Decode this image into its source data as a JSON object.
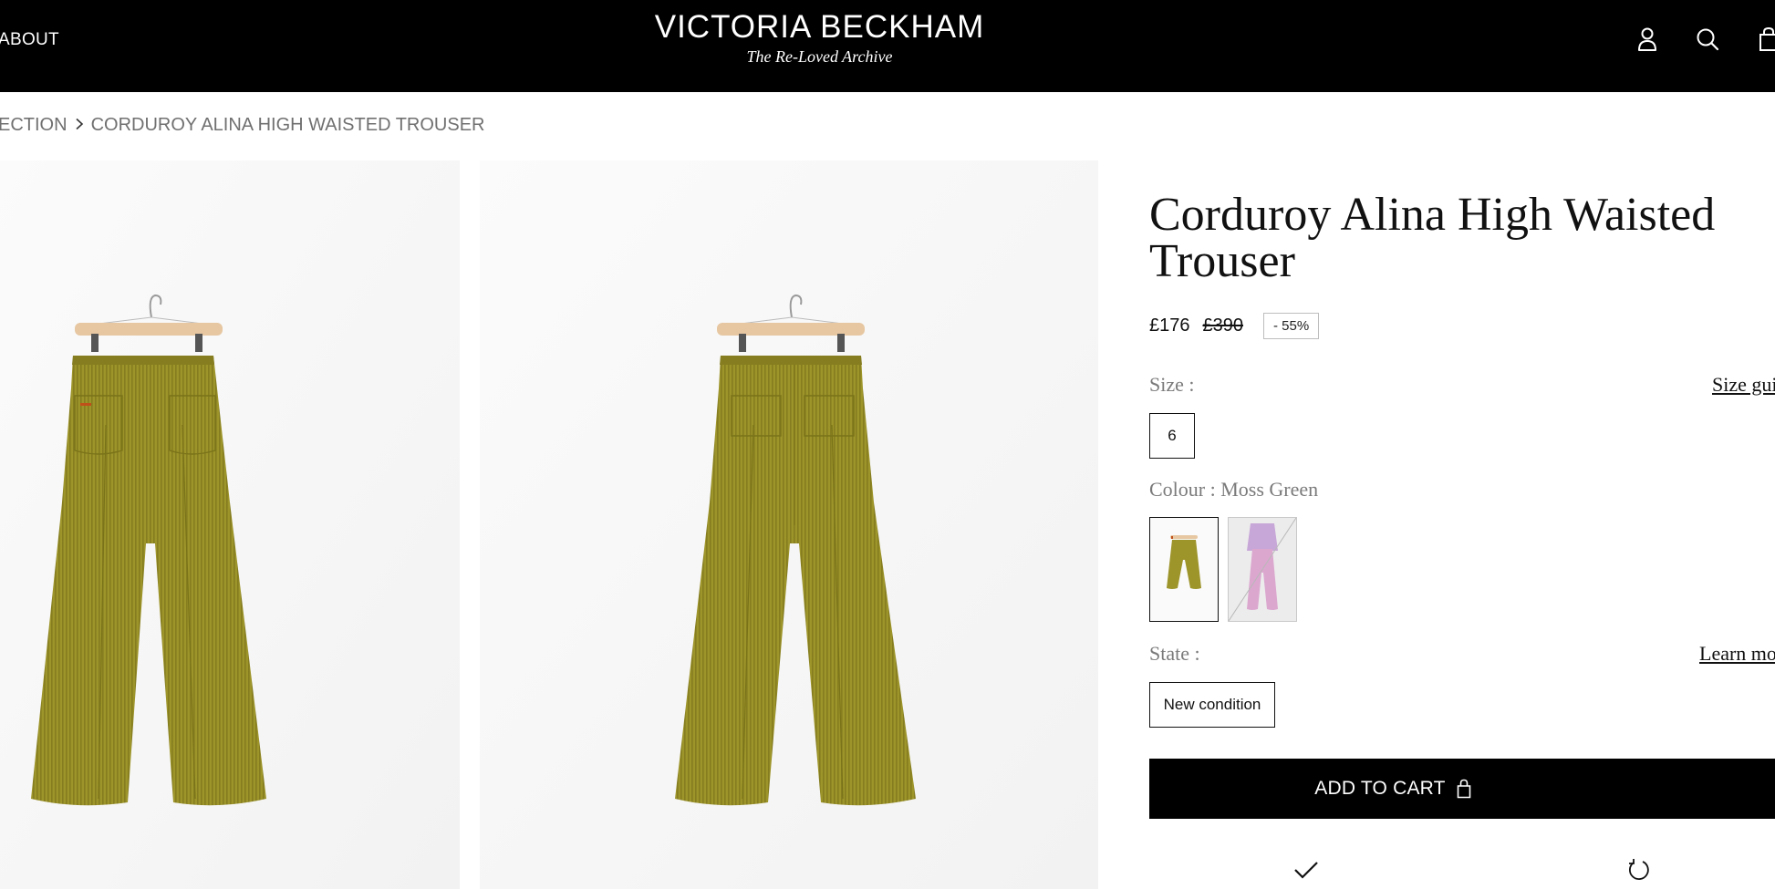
{
  "header": {
    "nav_about": "ABOUT",
    "brand_name": "VICTORIA BECKHAM",
    "brand_subtitle": "The Re-Loved Archive",
    "icons": [
      "account-icon",
      "search-icon",
      "shopping-bag-icon"
    ]
  },
  "breadcrumb": {
    "items": [
      "ECTION",
      "CORDUROY ALINA HIGH WAISTED TROUSER"
    ],
    "separator": "chevron-right-icon"
  },
  "product": {
    "title": "Corduroy Alina High Waisted Trouser",
    "price": "£176",
    "original_price": "£390",
    "discount": "- 55%",
    "size_label": "Size :",
    "size_guide_link": "Size gui",
    "sizes": [
      "6"
    ],
    "colour_label": "Colour : Moss Green",
    "colours": [
      "moss-green",
      "lilac"
    ],
    "state_label": "State :",
    "learn_more_link": "Learn mo",
    "states": [
      "New condition"
    ],
    "add_to_cart": "ADD TO CART",
    "trust_icons": [
      "checkmark-icon",
      "return-icon"
    ]
  },
  "colors": {
    "header_bg": "#000000",
    "trouser_green": "#9a9228",
    "lilac_swatch": "#d8a8cf",
    "hanger_wood": "#e6c7a2"
  }
}
